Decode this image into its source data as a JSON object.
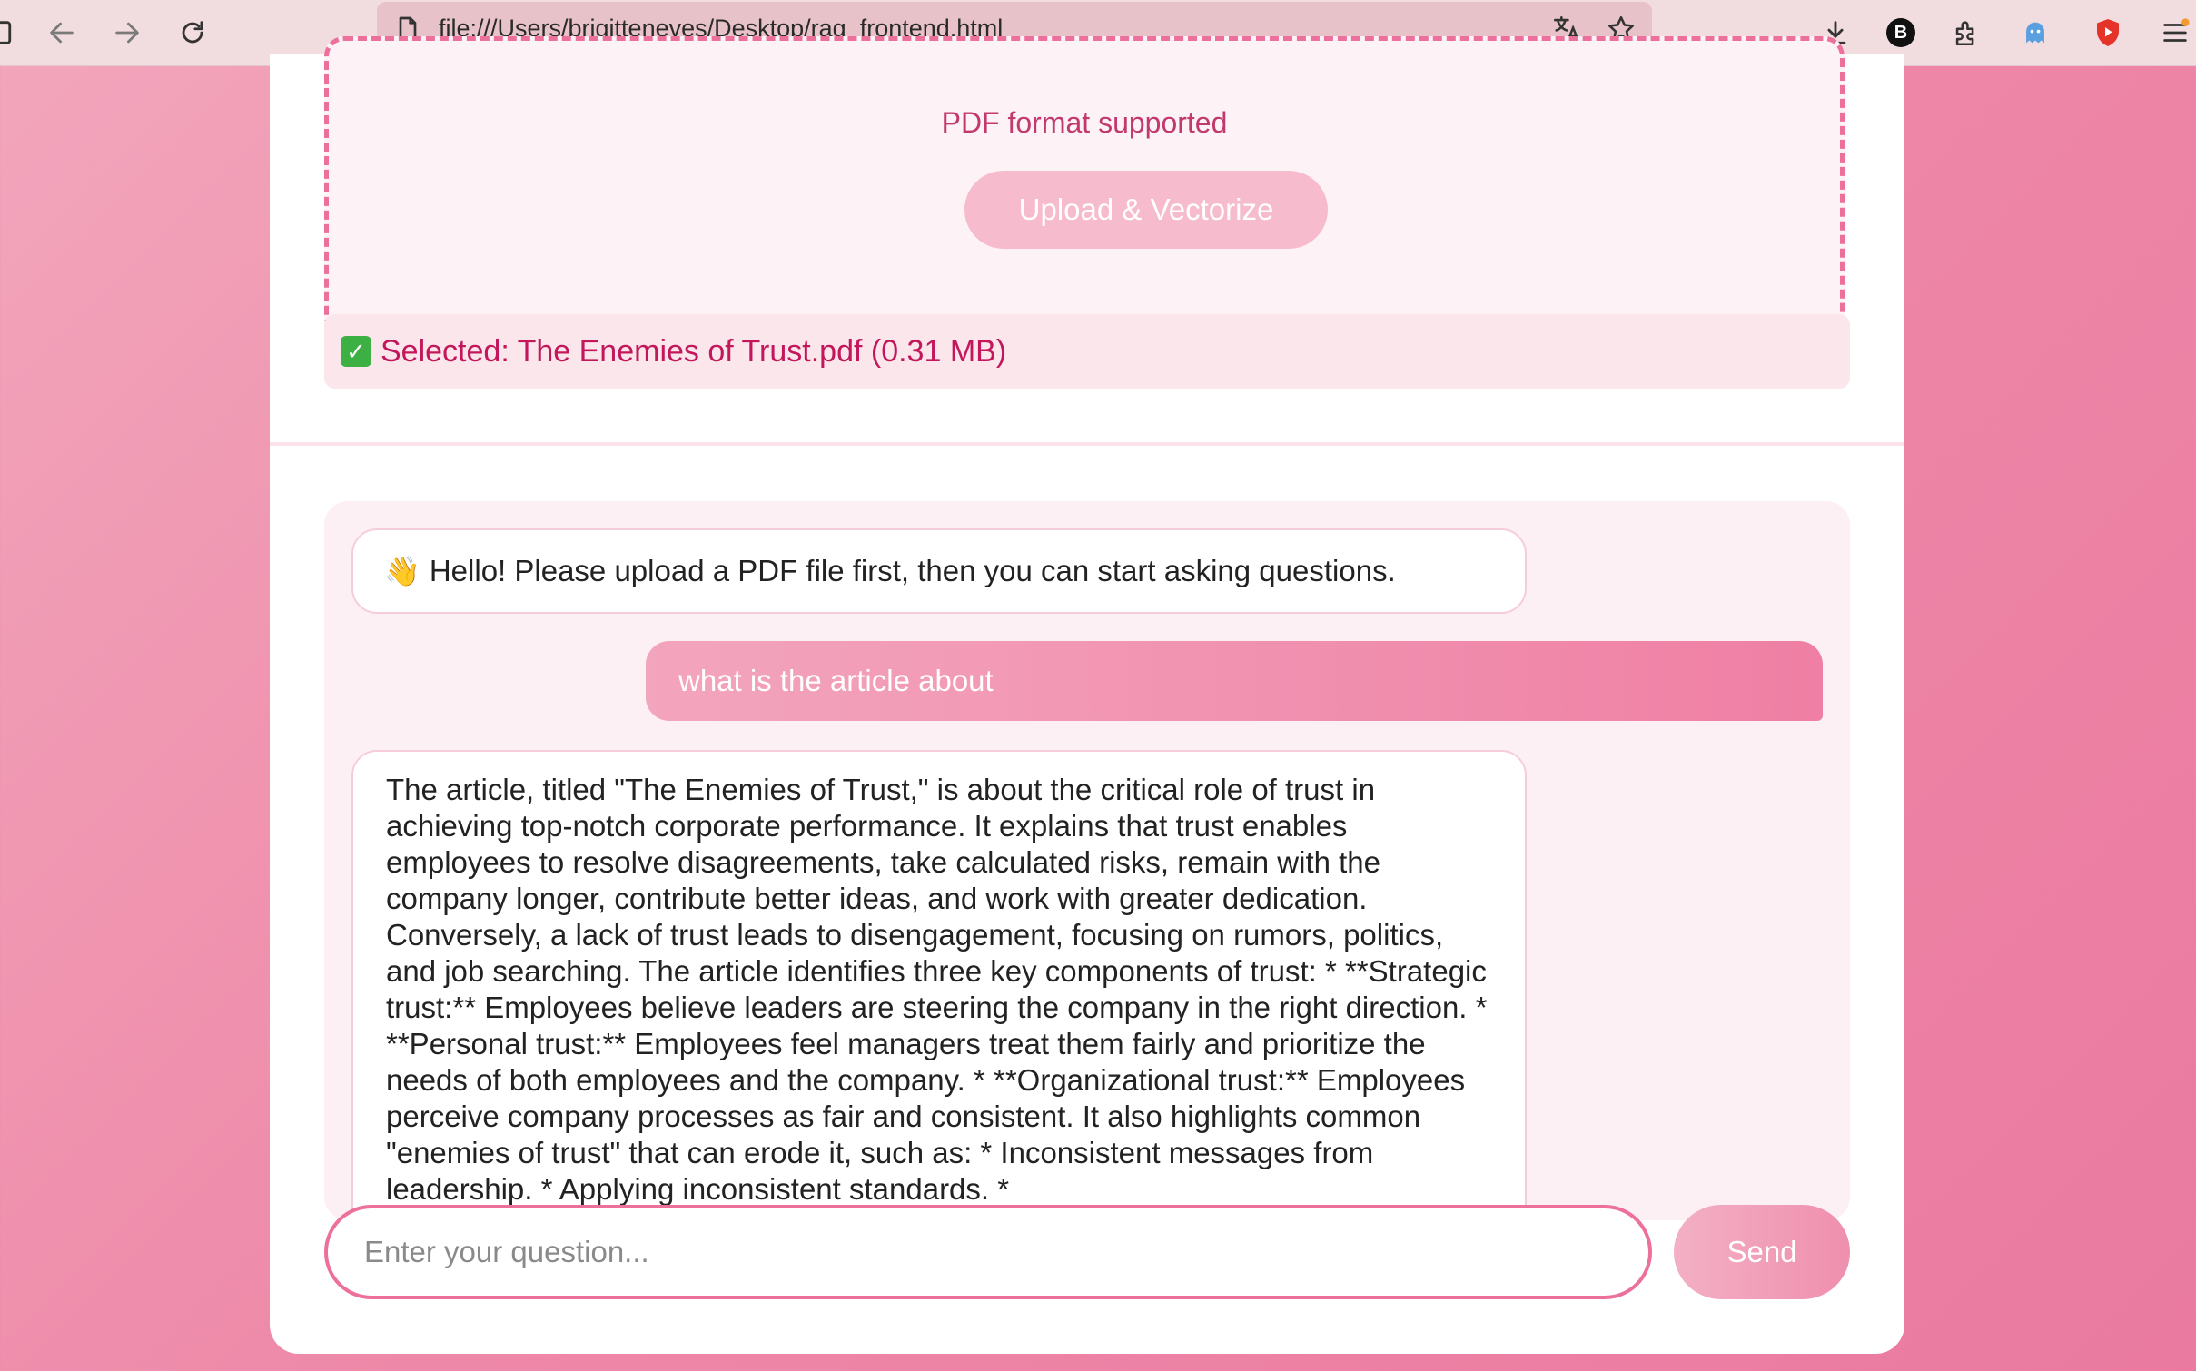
{
  "browser": {
    "url": "file:///Users/brigitteneves/Desktop/rag_frontend.html",
    "profile_initial": "B",
    "icons": [
      "back-icon",
      "forward-icon",
      "reload-icon",
      "page-icon",
      "translate-icon",
      "star-icon",
      "download-icon",
      "profile-icon",
      "extensions-icon",
      "ghost-extension-icon",
      "shield-extension-icon",
      "menu-icon"
    ]
  },
  "upload": {
    "hint": "PDF format supported",
    "button_label": "Upload & Vectorize",
    "status_text": "Selected: The Enemies of Trust.pdf (0.31 MB)"
  },
  "chat": {
    "messages": [
      {
        "role": "bot",
        "text": "Hello! Please upload a PDF file first, then you can start asking questions."
      },
      {
        "role": "user",
        "text": "what is the article about"
      },
      {
        "role": "bot",
        "text": "The article, titled \"The Enemies of Trust,\" is about the critical role of trust in achieving top-notch corporate performance. It explains that trust enables employees to resolve disagreements, take calculated risks, remain with the company longer, contribute better ideas, and work with greater dedication. Conversely, a lack of trust leads to disengagement, focusing on rumors, politics, and job searching. The article identifies three key components of trust: * **Strategic trust:** Employees believe leaders are steering the company in the right direction. * **Personal trust:** Employees feel managers treat them fairly and prioritize the needs of both employees and the company. * **Organizational trust:** Employees perceive company processes as fair and consistent. It also highlights common \"enemies of trust\" that can erode it, such as: * Inconsistent messages from leadership. * Applying inconsistent standards. *"
      }
    ],
    "input_placeholder": "Enter your question...",
    "send_label": "Send"
  },
  "colors": {
    "accent": "#ec6f9c",
    "status_text": "#c2185b",
    "background_gradient": [
      "#f2a6bc",
      "#ea7aa0"
    ]
  }
}
